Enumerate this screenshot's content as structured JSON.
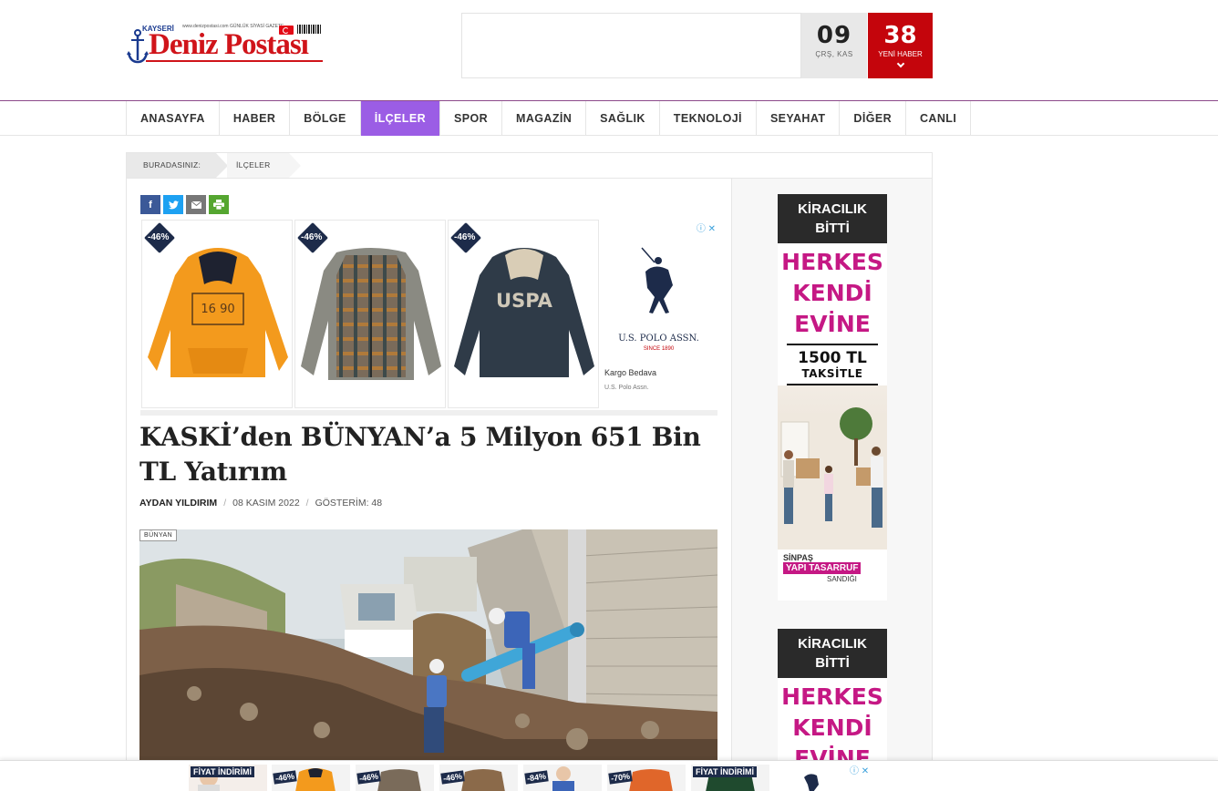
{
  "header": {
    "logo": {
      "city": "KAYSERİ",
      "title": "Deniz Postası",
      "tagline": "www.denizpostasi.com  GÜNLÜK SİYASİ GAZETE"
    },
    "date": {
      "day": "09",
      "sub": "ÇRŞ, KAS"
    },
    "news": {
      "count": "38",
      "label": "YENİ HABER"
    }
  },
  "nav": {
    "items": [
      "ANASAYFA",
      "HABER",
      "BÖLGE",
      "İLÇELER",
      "SPOR",
      "MAGAZİN",
      "SAĞLIK",
      "TEKNOLOJİ",
      "SEYAHAT",
      "DİĞER",
      "CANLI"
    ],
    "active_index": 3,
    "accent_color": "#9b5de5"
  },
  "breadcrumb": {
    "label": "BURADASINIZ:",
    "current": "İLÇELER"
  },
  "share": {
    "icons": [
      "facebook-icon",
      "twitter-icon",
      "mail-icon",
      "print-icon"
    ]
  },
  "ad": {
    "products": [
      {
        "discount": "-46%",
        "color": "#f39a1d"
      },
      {
        "discount": "-46%",
        "color": "#7a6b5a"
      },
      {
        "discount": "-46%",
        "color": "#2f3b48"
      }
    ],
    "brand": "U.S. POLO ASSN.",
    "brand_since": "SINCE 1890",
    "shipping": "Kargo Bedava",
    "advertiser": "U.S. Polo Assn."
  },
  "article": {
    "title": "KASKİ’den BÜNYAN’a 5 Milyon 651 Bin TL Yatırım",
    "author": "AYDAN YILDIRIM",
    "date": "08 KASIM 2022",
    "views": "GÖSTERİM: 48",
    "tag": "BÜNYAN"
  },
  "sidebar_ad": {
    "top": [
      "KİRACILIK",
      "BİTTİ"
    ],
    "mid": [
      "HERKES",
      "KENDİ",
      "EVİNE"
    ],
    "price": "1500 TL",
    "price_sub": "TAKSİTLE",
    "logo_top": "SİNPAŞ",
    "logo_main": "YAPI TASARRUF",
    "logo_sub": "SANDIĞI"
  },
  "bottom_bar": {
    "items": [
      "FİYAT İNDİRİMİ",
      "-46%",
      "-46%",
      "-46%",
      "-84%",
      "-70%",
      "FİYAT İNDİRİMİ"
    ]
  }
}
